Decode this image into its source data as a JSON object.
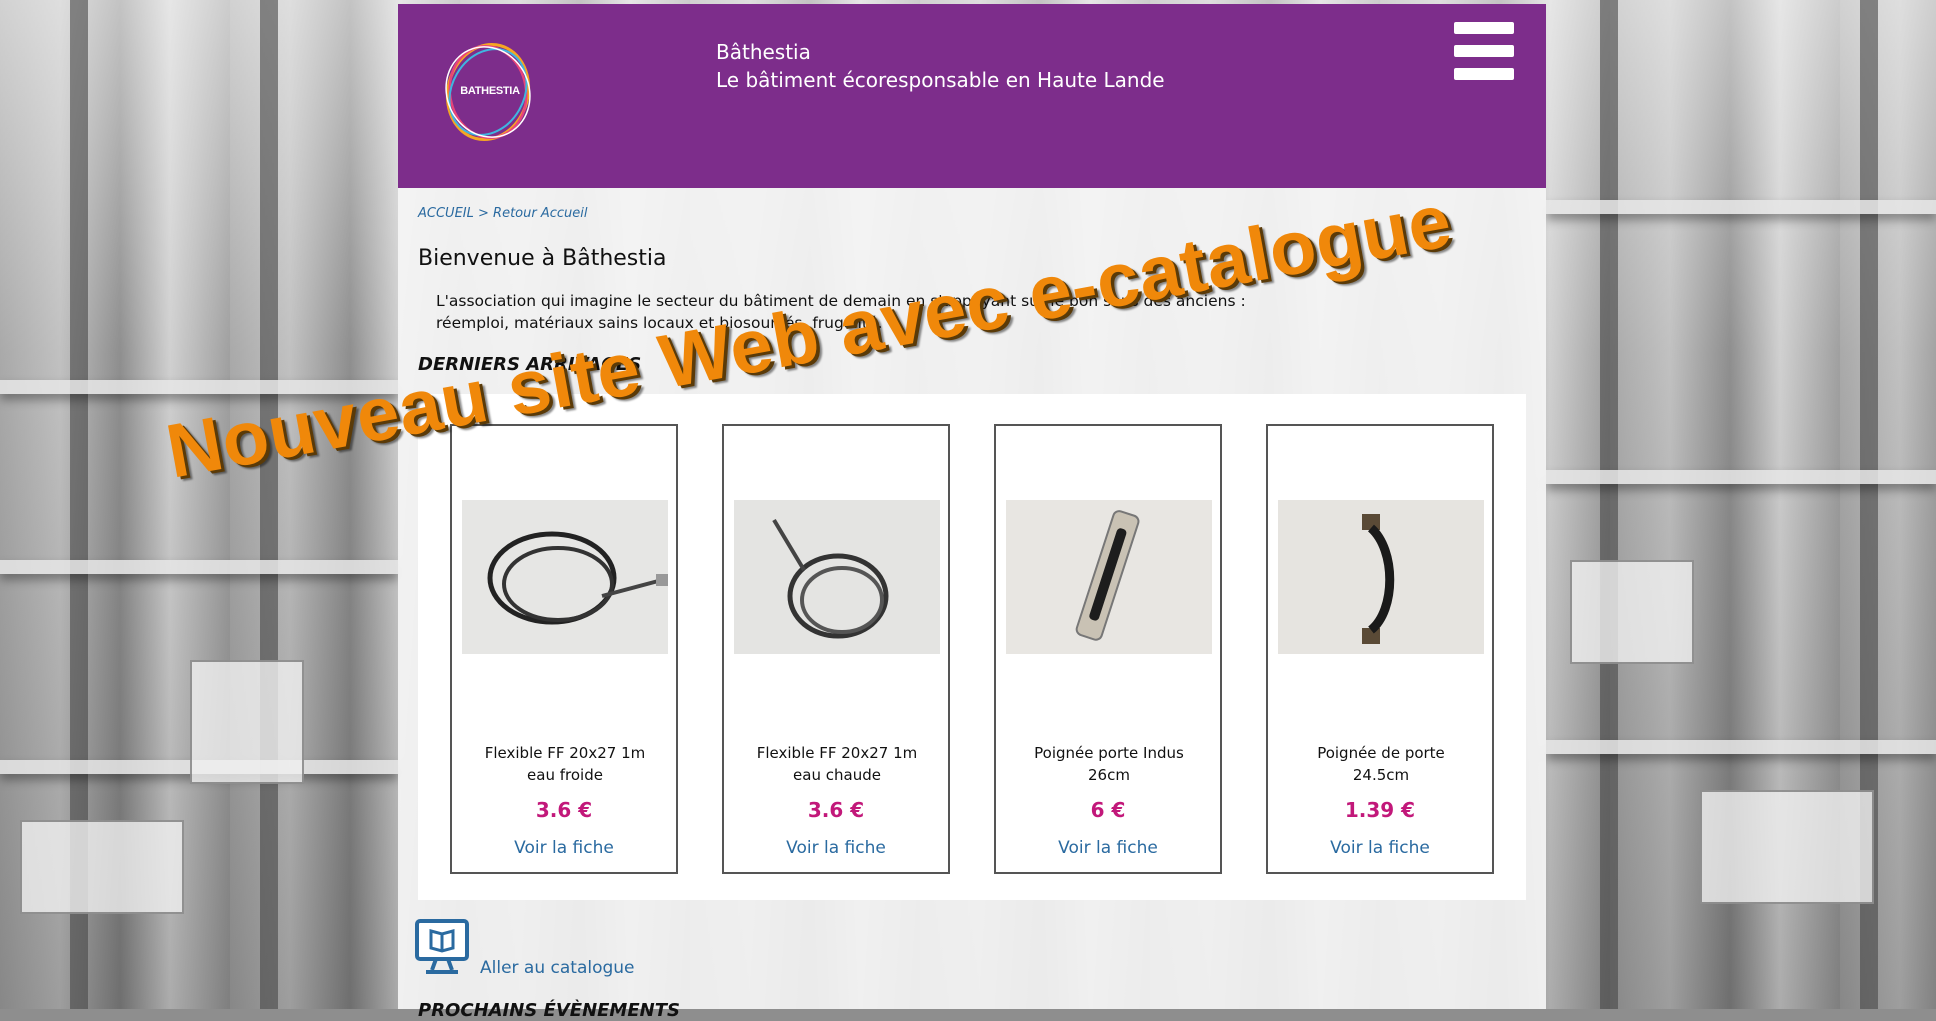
{
  "site": {
    "logo_text": "BATHESTIA",
    "title": "Bâthestia",
    "tagline": "Le bâtiment écoresponsable en Haute Lande"
  },
  "breadcrumb": {
    "home": "ACCUEIL",
    "separator": ">",
    "current": "Retour Accueil"
  },
  "welcome": {
    "heading": "Bienvenue à Bâthestia",
    "intro_line1": "L'association qui imagine le secteur du bâtiment de demain en s'appuyant sur le bon sens des anciens :",
    "intro_line2": "réemploi, matériaux sains locaux et biosourcés, frugalité."
  },
  "arrivals": {
    "heading": "DERNIERS ARRIVAGES",
    "products": [
      {
        "name_line1": "Flexible FF 20x27 1m",
        "name_line2": "eau froide",
        "price": "3.6 €",
        "link": "Voir la fiche"
      },
      {
        "name_line1": "Flexible FF 20x27 1m",
        "name_line2": "eau chaude",
        "price": "3.6 €",
        "link": "Voir la fiche"
      },
      {
        "name_line1": "Poignée porte Indus",
        "name_line2": "26cm",
        "price": "6 €",
        "link": "Voir la fiche"
      },
      {
        "name_line1": "Poignée de porte",
        "name_line2": "24.5cm",
        "price": "1.39 €",
        "link": "Voir la fiche"
      }
    ]
  },
  "catalog": {
    "link": "Aller au catalogue"
  },
  "events": {
    "heading": "PROCHAINS ÉVÈNEMENTS"
  },
  "overlay_text": "Nouveau site Web avec e-catalogue",
  "colors": {
    "header": "#7d2d8b",
    "price": "#c2187a",
    "link": "#2a6aa0",
    "overlay": "#f0880a"
  }
}
